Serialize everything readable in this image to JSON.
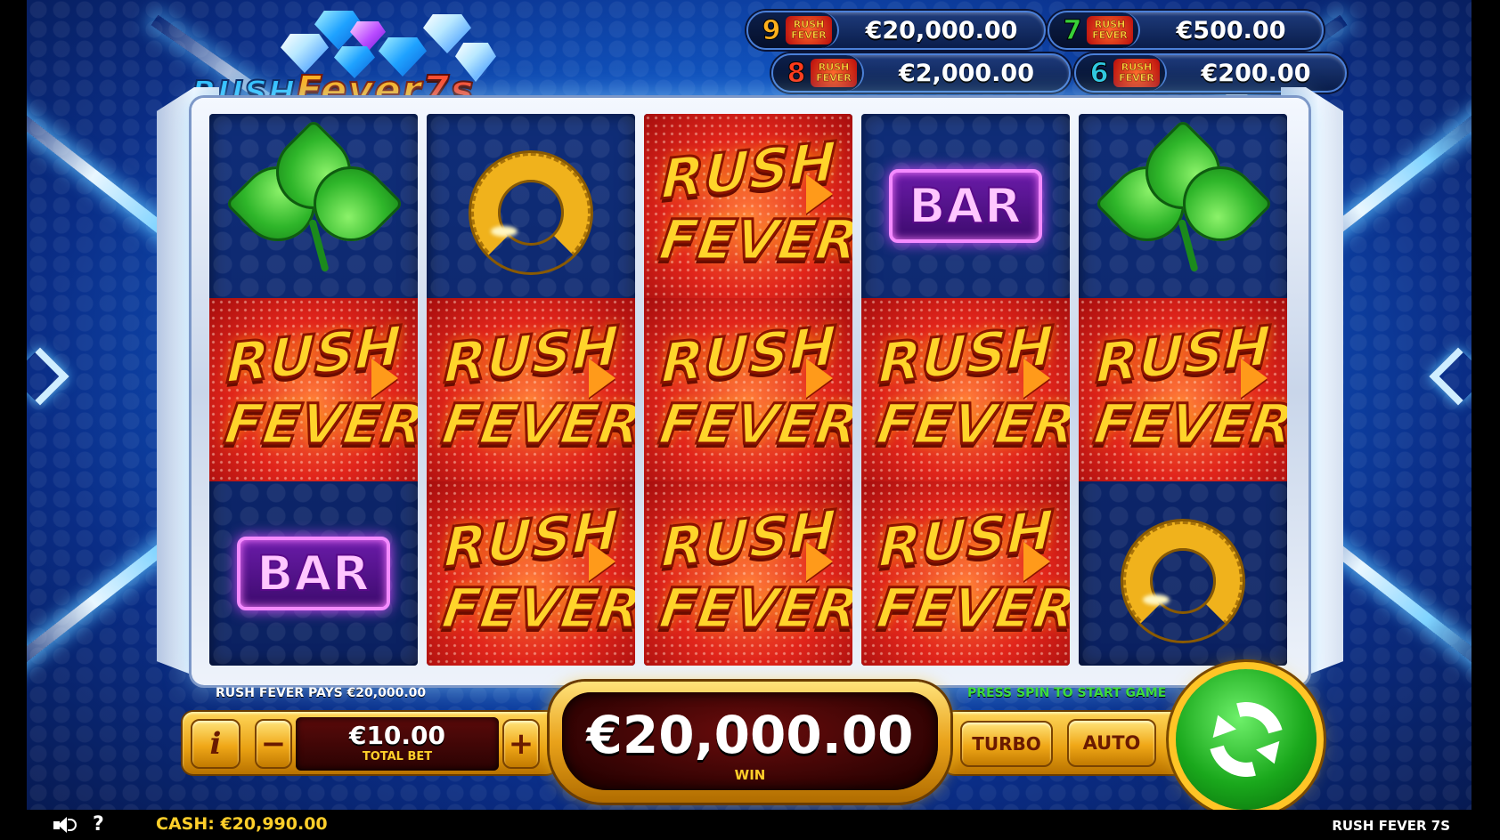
{
  "game": {
    "logo": "RUSH Fever 7s",
    "logo_parts": [
      "RUSH",
      "Fever",
      "7s"
    ],
    "name": "RUSH FEVER 7S"
  },
  "jackpots": [
    {
      "count": "9",
      "value": "€20,000.00",
      "color": "#ffb01c"
    },
    {
      "count": "7",
      "value": "€500.00",
      "color": "#38d038"
    },
    {
      "count": "8",
      "value": "€2,000.00",
      "color": "#ff3a1a"
    },
    {
      "count": "6",
      "value": "€200.00",
      "color": "#2fc8e0"
    }
  ],
  "jackpot_symbol": {
    "line1": "RUSH",
    "line2": "FEVER"
  },
  "reels": [
    [
      "clover",
      "rush-fever",
      "bar"
    ],
    [
      "horseshoe",
      "rush-fever",
      "rush-fever"
    ],
    [
      "rush-fever",
      "rush-fever",
      "rush-fever"
    ],
    [
      "bar",
      "rush-fever",
      "rush-fever"
    ],
    [
      "clover",
      "rush-fever",
      "horseshoe"
    ]
  ],
  "symbols": {
    "rush_fever": {
      "line1": "RUSH",
      "line2": "FEVER"
    },
    "bar": "BAR"
  },
  "messages": {
    "left": "RUSH FEVER PAYS €20,000.00",
    "right": "PRESS SPIN TO START GAME"
  },
  "controls": {
    "info": "i",
    "minus": "−",
    "plus": "+",
    "total_bet_value": "€10.00",
    "total_bet_label": "TOTAL BET",
    "win_value": "€20,000.00",
    "win_label": "WIN",
    "turbo": "TURBO",
    "auto": "AUTO"
  },
  "footer": {
    "help": "?",
    "cash": "CASH:  €20,990.00"
  },
  "icons": [
    "sound-icon",
    "help-icon",
    "spin-icon",
    "info-icon"
  ]
}
